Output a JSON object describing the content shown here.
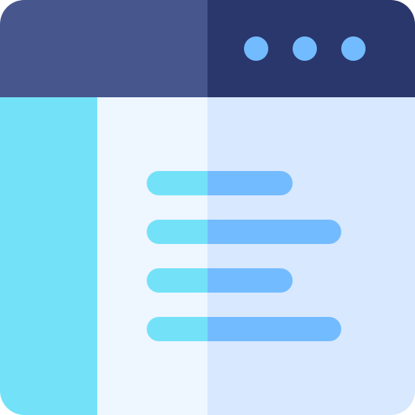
{
  "icon": {
    "name": "browser-window-icon",
    "colors": {
      "titlebar_left": "#47578E",
      "titlebar_right": "#2A376C",
      "dot": "#73BBFF",
      "sidebar": "#73E2F8",
      "content_left": "#EEF6FF",
      "content_right": "#D7E8FF",
      "line_left": "#73E2F8",
      "line_right": "#73BBFF"
    },
    "dots": 3,
    "text_lines": [
      {
        "length": "short"
      },
      {
        "length": "long"
      },
      {
        "length": "short"
      },
      {
        "length": "long"
      }
    ]
  }
}
